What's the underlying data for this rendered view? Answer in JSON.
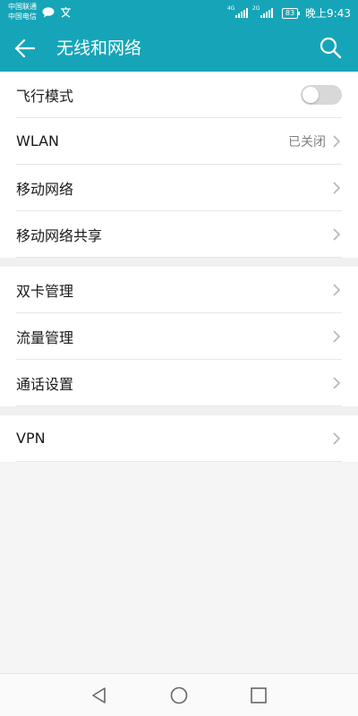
{
  "status": {
    "carrier_1": "中国联通",
    "carrier_2": "中国电信",
    "net_1": "4G",
    "net_2": "2G",
    "battery": "83",
    "time": "晚上9:43",
    "icons": [
      "chat-bubble-icon",
      "translate-icon"
    ]
  },
  "app_bar": {
    "title": "无线和网络",
    "color": "#16a5b8"
  },
  "settings_groups": [
    {
      "items": [
        {
          "label": "飞行模式",
          "control": "toggle",
          "state": "off"
        },
        {
          "label": "WLAN",
          "value": "已关闭",
          "control": "chevron"
        },
        {
          "label": "移动网络",
          "control": "chevron"
        },
        {
          "label": "移动网络共享",
          "control": "chevron"
        }
      ]
    },
    {
      "items": [
        {
          "label": "双卡管理",
          "control": "chevron"
        },
        {
          "label": "流量管理",
          "control": "chevron"
        },
        {
          "label": "通话设置",
          "control": "chevron"
        }
      ]
    },
    {
      "items": [
        {
          "label": "VPN",
          "control": "chevron"
        }
      ]
    }
  ],
  "nav": [
    "back-triangle-icon",
    "home-circle-icon",
    "recents-square-icon"
  ]
}
